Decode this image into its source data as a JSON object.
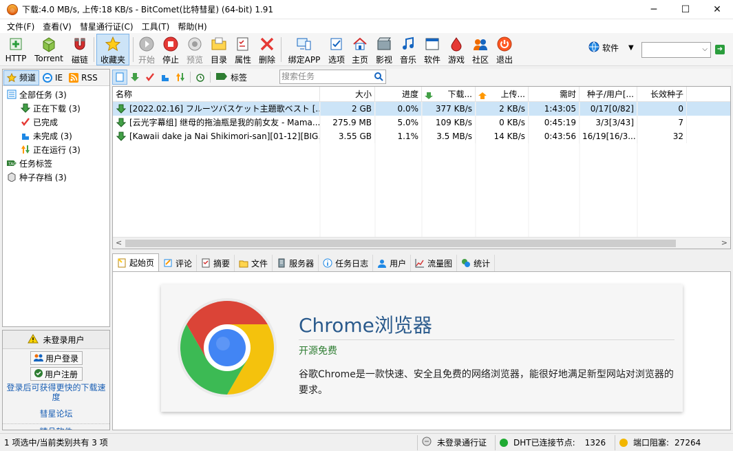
{
  "window": {
    "title": "下载:4.0 MB/s, 上传:18 KB/s - BitComet(比特彗星) (64-bit) 1.91",
    "minimize": "─",
    "maximize": "☐",
    "close": "✕"
  },
  "menu": [
    "文件(F)",
    "查看(V)",
    "彗星通行证(C)",
    "工具(T)",
    "帮助(H)"
  ],
  "toolbar": {
    "http": "HTTP",
    "torrent": "Torrent",
    "magnet": "磁链",
    "favorites": "收藏夹",
    "start": "开始",
    "stop": "停止",
    "preview": "预览",
    "folder": "目录",
    "properties": "属性",
    "delete": "删除",
    "bind_app": "绑定APP",
    "options": "选项",
    "home": "主页",
    "video": "影视",
    "music": "音乐",
    "software": "软件",
    "games": "游戏",
    "community": "社区",
    "exit": "退出",
    "search_category": "软件",
    "search_value": ""
  },
  "left_tabs": [
    "频道",
    "IE",
    "RSS"
  ],
  "tree": {
    "all_tasks": "全部任务 (3)",
    "downloading": "正在下载 (3)",
    "completed": "已完成",
    "incomplete": "未完成 (3)",
    "running": "正在运行 (3)",
    "task_tags": "任务标签",
    "seed_archive": "种子存档 (3)"
  },
  "login": {
    "status": "未登录用户",
    "login_button": "用户登录",
    "register_button": "用户注册",
    "faster_link": "登录后可获得更快的下载速度",
    "forum_link": "彗星论坛",
    "more_link": "精品软件"
  },
  "task_toolbar": {
    "tags_label": "标签",
    "search_placeholder": "搜索任务"
  },
  "columns": {
    "name": "名称",
    "size": "大小",
    "progress": "进度",
    "download": "下载...",
    "upload": "上传...",
    "time_left": "需时",
    "seeds": "种子/用户[...",
    "long_seeds": "长效种子"
  },
  "tasks": [
    {
      "name": "[2022.02.16] フルーツバスケット主題歌ベスト [...",
      "size": "2 GB",
      "progress": "0.0%",
      "download": "377 KB/s",
      "upload": "2 KB/s",
      "time_left": "1:43:05",
      "seeds": "0/17[0/82]",
      "long_seeds": "0"
    },
    {
      "name": "[云光字幕组] 继母的拖油瓶是我的前女友 - Mama...",
      "size": "275.9 MB",
      "progress": "5.0%",
      "download": "109 KB/s",
      "upload": "0 KB/s",
      "time_left": "0:45:19",
      "seeds": "3/3[3/43]",
      "long_seeds": "7"
    },
    {
      "name": "[Kawaii dake ja Nai Shikimori-san][01-12][BIG...",
      "size": "3.55 GB",
      "progress": "1.1%",
      "download": "3.5 MB/s",
      "upload": "14 KB/s",
      "time_left": "0:43:56",
      "seeds": "16/19[16/3...",
      "long_seeds": "32"
    }
  ],
  "detail_tabs": [
    "起始页",
    "评论",
    "摘要",
    "文件",
    "服务器",
    "任务日志",
    "用户",
    "流量图",
    "统计"
  ],
  "promo": {
    "title": "Chrome浏览器",
    "subtitle": "开源免费",
    "description": "谷歌Chrome是一款快速、安全且免费的网络浏览器，能很好地满足新型网站对浏览器的要求。"
  },
  "status": {
    "selection": "1 项选中/当前类别共有 3 项",
    "passport": "未登录通行证",
    "dht_label": "DHT已连接节点:",
    "dht_nodes": "1326",
    "port_label": "端口阻塞:",
    "port_value": "27264"
  },
  "colors": {
    "accent": "#cde4f7",
    "dht_dot": "#1faa33",
    "port_dot": "#f2b600"
  }
}
